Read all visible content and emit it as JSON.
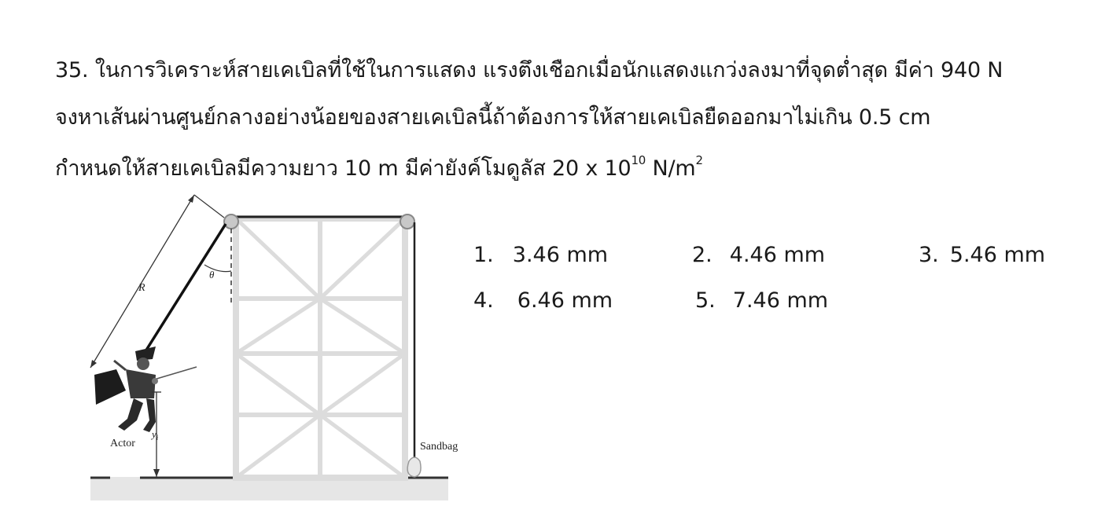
{
  "question": {
    "line1": "35. ในการวิเคราะห์สายเคเบิลที่ใช้ในการแสดง   แรงตึงเชือกเมื่อนักแสดงแกว่งลงมาที่จุดต่ำสุด  มีค่า 940 N",
    "line2": "จงหาเส้นผ่านศูนย์กลางอย่างน้อยของสายเคเบิลนี้ถ้าต้องการให้สายเคเบิลยืดออกมาไม่เกิน 0.5 cm",
    "line3_pre": "กำหนดให้สายเคเบิลมีความยาว 10 m  มีค่ายังค์โมดูลัส 20 x 10",
    "line3_exp": "10",
    "line3_unit": " N/m",
    "line3_unit_exp": "2"
  },
  "figure": {
    "label_R": "R",
    "label_theta": "θ",
    "label_actor": "Actor",
    "label_yi": "y",
    "label_yi_sub": "i",
    "label_sandbag": "Sandbag"
  },
  "choices": [
    {
      "num": "1.",
      "value": "3.46 mm"
    },
    {
      "num": "2.",
      "value": "4.46 mm"
    },
    {
      "num": "3.",
      "value": "5.46 mm"
    },
    {
      "num": "4.",
      "value": "6.46 mm"
    },
    {
      "num": "5.",
      "value": "7.46 mm"
    }
  ]
}
